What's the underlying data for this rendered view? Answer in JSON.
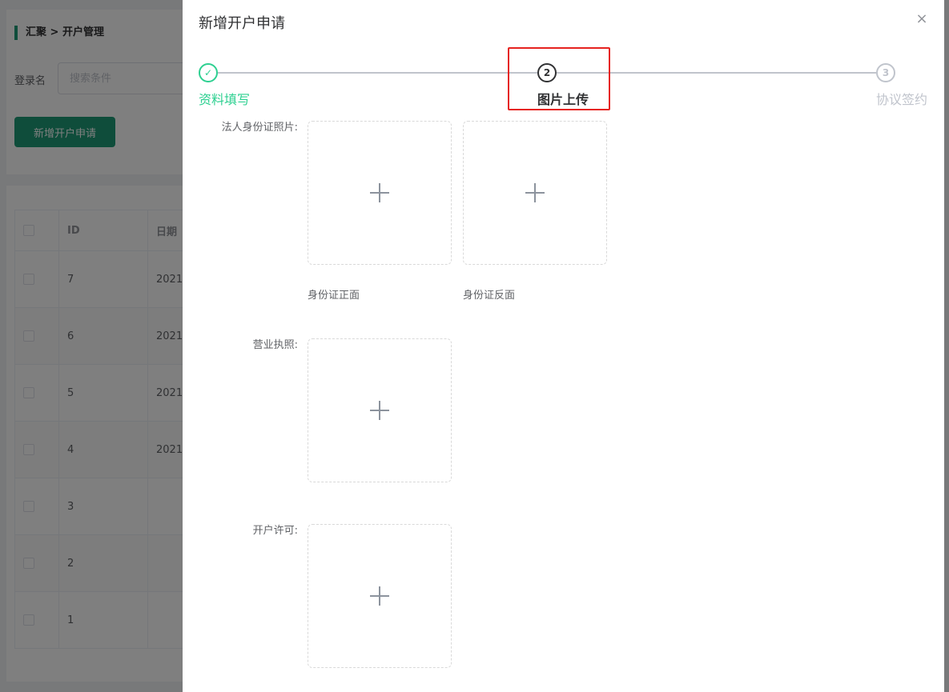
{
  "page": {
    "breadcrumb": "汇聚 > 开户管理",
    "login_label": "登录名",
    "search_placeholder": "搜索条件",
    "add_button": "新增开户申请",
    "table": {
      "headers": [
        "",
        "ID",
        "日期"
      ],
      "rows": [
        {
          "id": "7",
          "date": "2021-"
        },
        {
          "id": "6",
          "date": "2021-"
        },
        {
          "id": "5",
          "date": "2021-"
        },
        {
          "id": "4",
          "date": "2021-"
        },
        {
          "id": "3",
          "date": ""
        },
        {
          "id": "2",
          "date": ""
        },
        {
          "id": "1",
          "date": ""
        }
      ]
    }
  },
  "drawer": {
    "title": "新增开户申请",
    "close_symbol": "×",
    "steps": [
      {
        "number": "✓",
        "label": "资料填写",
        "status": "finished"
      },
      {
        "number": "2",
        "label": "图片上传",
        "status": "process"
      },
      {
        "number": "3",
        "label": "协议签约",
        "status": "wait"
      }
    ],
    "fields": {
      "id_card_label": "法人身份证照片:",
      "id_front_caption": "身份证正面",
      "id_back_caption": "身份证反面",
      "license_label": "营业执照:",
      "permit_label": "开户许可:"
    }
  },
  "colors": {
    "accent": "#1e9b76",
    "step_finished": "#2ed091",
    "highlight": "#e6231f"
  }
}
